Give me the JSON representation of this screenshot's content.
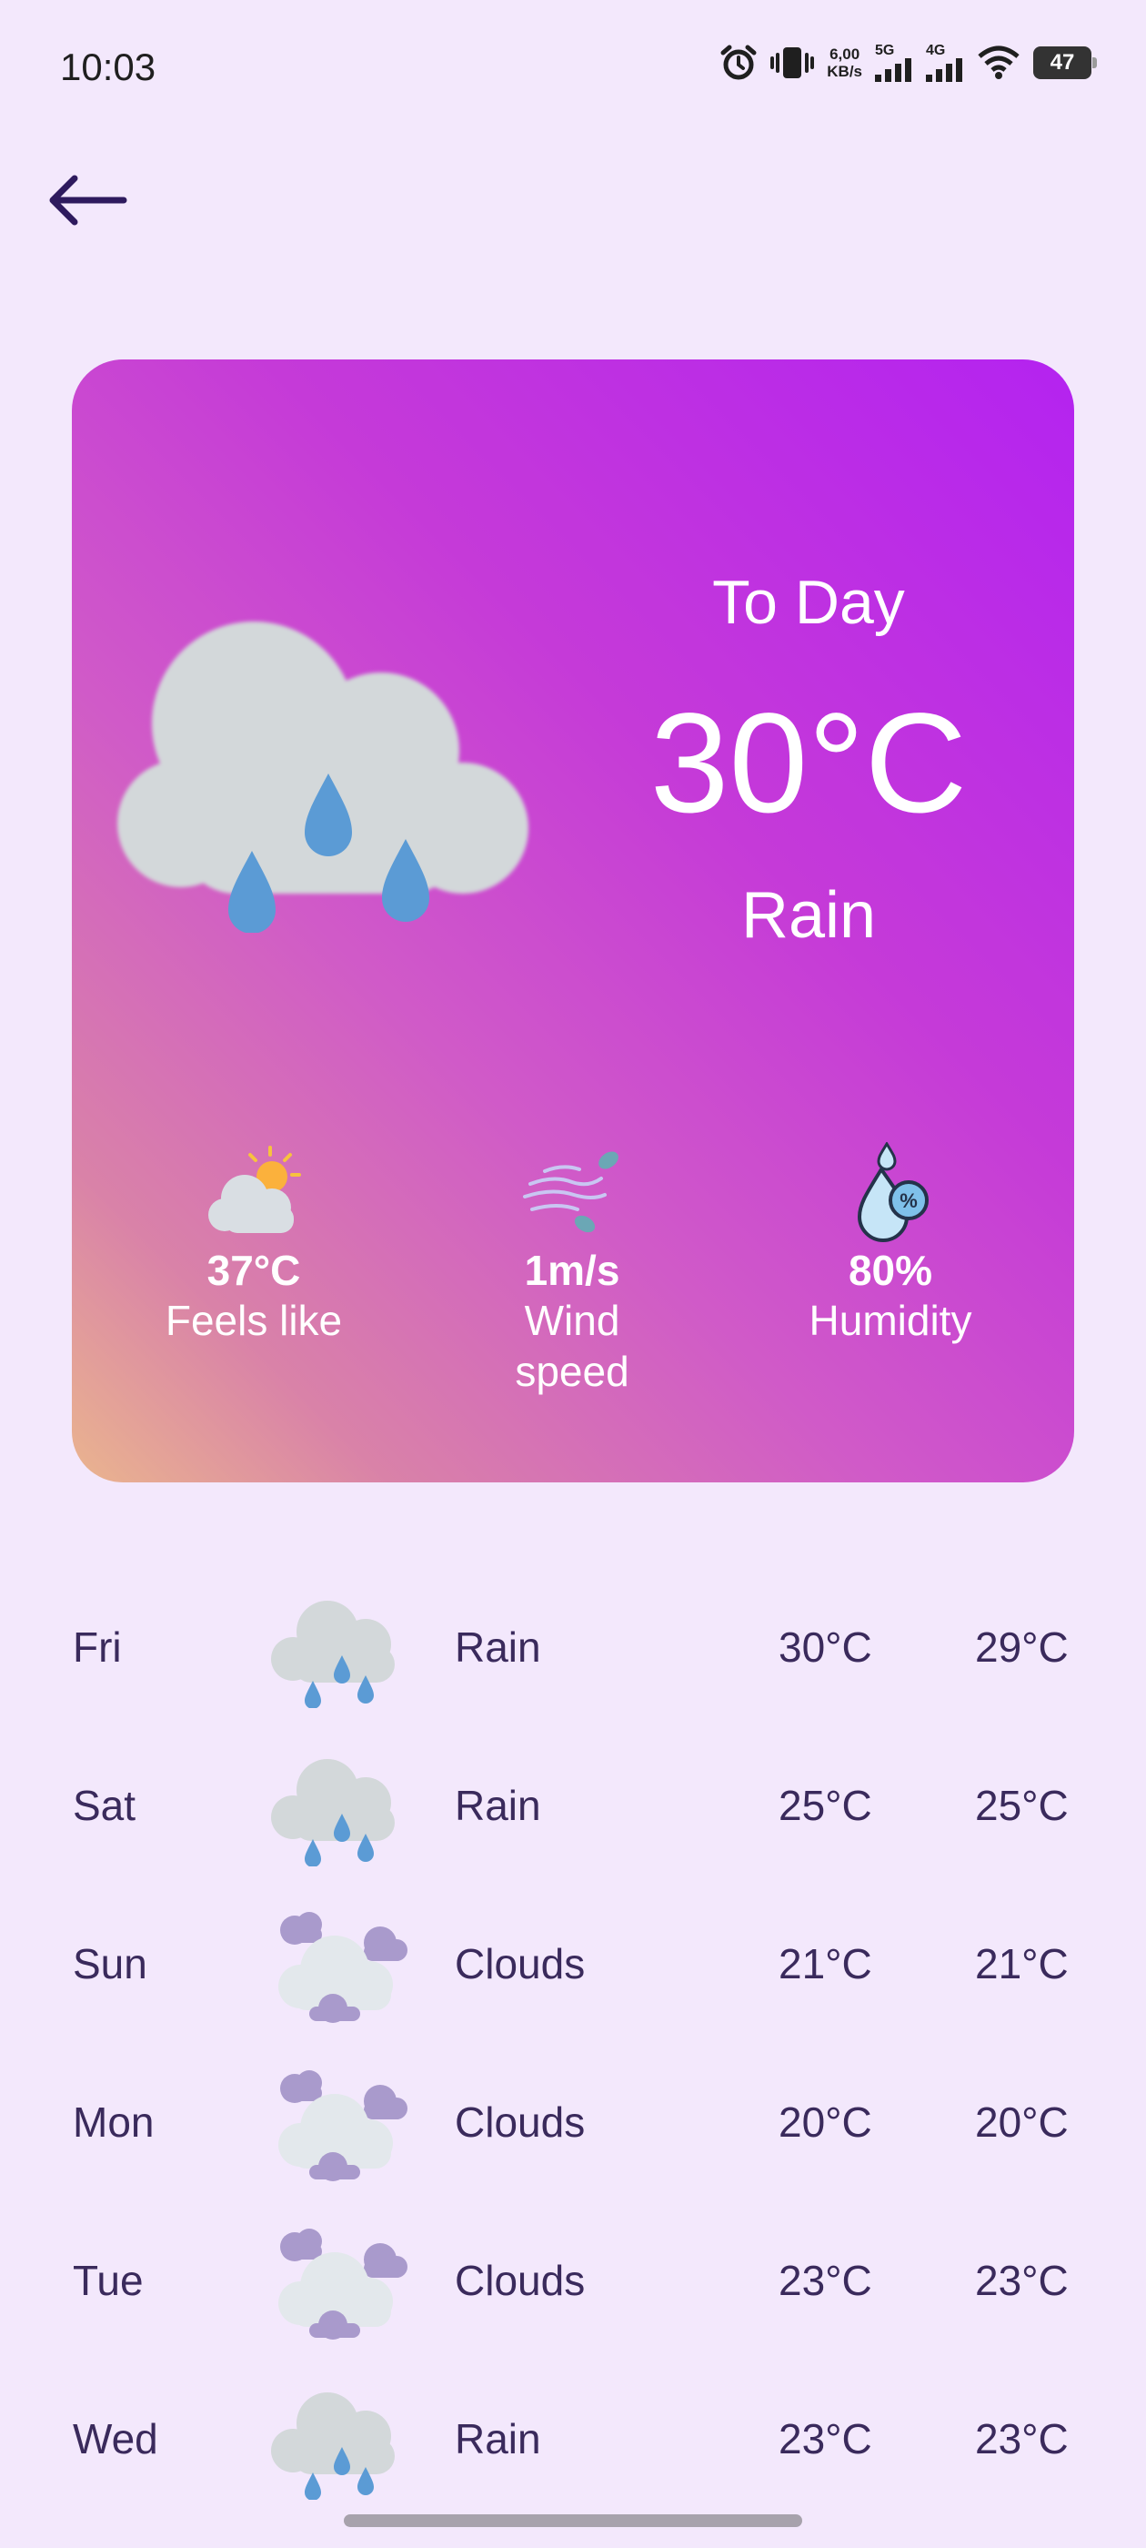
{
  "status_bar": {
    "time": "10:03",
    "net_speed_value": "6,00",
    "net_speed_unit": "KB/s",
    "signal1_label": "5G",
    "signal2_label": "4G",
    "battery": "47"
  },
  "today": {
    "label": "To Day",
    "temp": "30°C",
    "condition": "Rain",
    "icon": "rain-cloud-icon"
  },
  "metrics": [
    {
      "value": "37°C",
      "label": "Feels like",
      "icon": "partly-cloudy-icon"
    },
    {
      "value": "1m/s",
      "label": "Wind speed",
      "icon": "wind-icon"
    },
    {
      "value": "80%",
      "label": "Humidity",
      "icon": "humidity-icon"
    }
  ],
  "forecast": [
    {
      "day": "Fri",
      "condition": "Rain",
      "temp_high": "30°C",
      "temp_low": "29°C",
      "icon": "rain-cloud-icon"
    },
    {
      "day": "Sat",
      "condition": "Rain",
      "temp_high": "25°C",
      "temp_low": "25°C",
      "icon": "rain-cloud-icon"
    },
    {
      "day": "Sun",
      "condition": "Clouds",
      "temp_high": "21°C",
      "temp_low": "21°C",
      "icon": "clouds-icon"
    },
    {
      "day": "Mon",
      "condition": "Clouds",
      "temp_high": "20°C",
      "temp_low": "20°C",
      "icon": "clouds-icon"
    },
    {
      "day": "Tue",
      "condition": "Clouds",
      "temp_high": "23°C",
      "temp_low": "23°C",
      "icon": "clouds-icon"
    },
    {
      "day": "Wed",
      "condition": "Rain",
      "temp_high": "23°C",
      "temp_low": "23°C",
      "icon": "rain-cloud-icon"
    }
  ],
  "colors": {
    "background": "#F3E8FC",
    "text": "#3A2A5C",
    "card_gradient_top": "#B423F0",
    "card_gradient_bottom": "#EAB58E",
    "rain_drop": "#5B9BD5",
    "cloud": "#D3D8DA"
  }
}
